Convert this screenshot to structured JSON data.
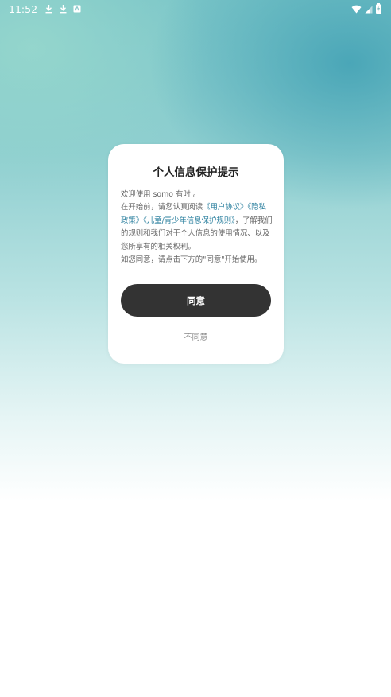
{
  "status_bar": {
    "time": "11:52",
    "left_icons": [
      "download-icon",
      "download-icon",
      "app-notification-icon"
    ],
    "right_icons": [
      "wifi-icon",
      "cell-signal-icon",
      "battery-charging-icon"
    ]
  },
  "dialog": {
    "title": "个人信息保护提示",
    "line1": "欢迎使用 somo 有时 。",
    "line2_prefix": "在开始前，请您认真阅读",
    "link_user_agreement": "《用户协议》",
    "link_privacy_policy": "《隐私政策》",
    "link_children_rules": "《儿童/青少年信息保护规则》",
    "line2_suffix": "，了解我们的规则和我们对于个人信息的使用情况、以及您所享有的相关权利。",
    "line3": "如您同意，请点击下方的\"同意\"开始使用。",
    "agree_label": "同意",
    "disagree_label": "不同意"
  },
  "colors": {
    "link": "#2a7f9e",
    "agree_button_bg": "#333333",
    "status_text": "#ffffff"
  }
}
